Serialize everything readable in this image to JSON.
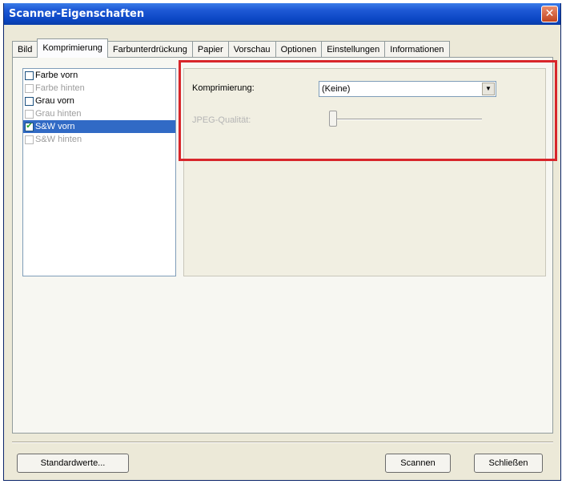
{
  "window": {
    "title": "Scanner-Eigenschaften",
    "close_glyph": "✕"
  },
  "tabs": [
    {
      "label": "Bild"
    },
    {
      "label": "Komprimierung",
      "active": true
    },
    {
      "label": "Farbunterdrückung"
    },
    {
      "label": "Papier"
    },
    {
      "label": "Vorschau"
    },
    {
      "label": "Optionen"
    },
    {
      "label": "Einstellungen"
    },
    {
      "label": "Informationen"
    }
  ],
  "image_list": [
    {
      "label": "Farbe vorn",
      "checked": false,
      "enabled": true
    },
    {
      "label": "Farbe hinten",
      "checked": false,
      "enabled": false
    },
    {
      "label": "Grau vorn",
      "checked": false,
      "enabled": true
    },
    {
      "label": "Grau hinten",
      "checked": false,
      "enabled": false
    },
    {
      "label": "S&W vorn",
      "checked": true,
      "enabled": true,
      "selected": true
    },
    {
      "label": "S&W hinten",
      "checked": false,
      "enabled": false
    }
  ],
  "compression": {
    "label": "Komprimierung:",
    "selected_value": "(Keine)",
    "jpeg_quality_label": "JPEG-Qualität:",
    "jpeg_quality_level": 0
  },
  "buttons": {
    "defaults": "Standardwerte...",
    "scan": "Scannen",
    "close": "Schließen"
  },
  "colors": {
    "title_bar": "#0b46c4",
    "selection": "#316ac5",
    "highlight_annotation": "#d8262b"
  }
}
